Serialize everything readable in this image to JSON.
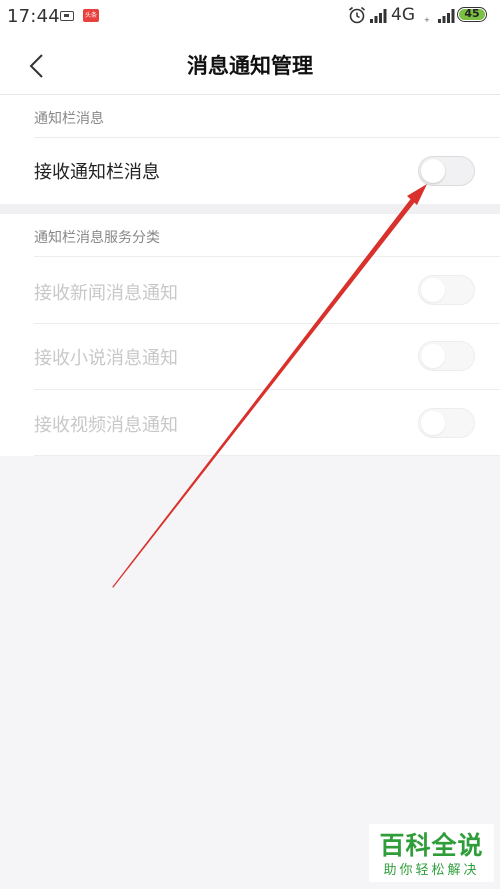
{
  "status_bar": {
    "time": "17:44",
    "app_badge": "头条",
    "network": "4G",
    "network_sub": "+",
    "battery": "45"
  },
  "header": {
    "title": "消息通知管理"
  },
  "sections": [
    {
      "header": "通知栏消息",
      "rows": [
        {
          "label": "接收通知栏消息",
          "toggle": "off",
          "enabled": true
        }
      ]
    },
    {
      "header": "通知栏消息服务分类",
      "rows": [
        {
          "label": "接收新闻消息通知",
          "toggle": "off",
          "enabled": false
        },
        {
          "label": "接收小说消息通知",
          "toggle": "off",
          "enabled": false
        },
        {
          "label": "接收视频消息通知",
          "toggle": "off",
          "enabled": false
        }
      ]
    }
  ],
  "watermark": {
    "title": "百科全说",
    "subtitle": "助你轻松解决"
  },
  "colors": {
    "annotation_arrow": "#d9312b",
    "watermark_green": "#2f9e3a",
    "battery_fill": "#7bc043"
  }
}
